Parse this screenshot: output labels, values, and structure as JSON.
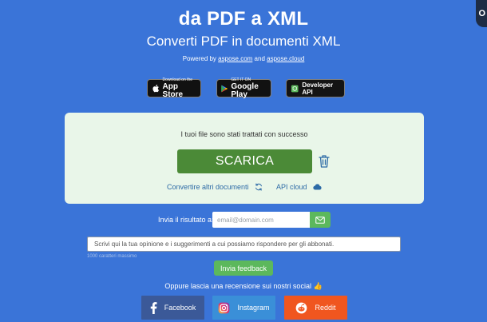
{
  "header": {
    "corner_label": "O",
    "title": "da PDF a XML",
    "subtitle": "Converti PDF in documenti XML",
    "powered_by": "Powered by",
    "powered_link1": "aspose.com",
    "powered_and": "and",
    "powered_link2": "aspose.cloud"
  },
  "stores": {
    "appstore_small": "Download on the",
    "appstore_big": "App Store",
    "googleplay_small": "GET IT ON",
    "googleplay_big": "Google Play",
    "devapi": "Developer API"
  },
  "result_panel": {
    "success_message": "I tuoi file sono stati trattati con successo",
    "download_label": "SCARICA",
    "convert_more": "Convertire altri documenti",
    "api_cloud": "API cloud"
  },
  "send_result": {
    "label": "Invia il risultato a:",
    "email_placeholder": "email@domain.com"
  },
  "feedback": {
    "placeholder": "Scrivi qui la tua opinione e i suggerimenti a cui possiamo rispondere per gli abbonati.",
    "char_limit": "1000 caratteri massimo",
    "submit_label": "Invia feedback",
    "review_text": "Oppure lascia una recensione sui nostri social 👍"
  },
  "social": {
    "facebook": "Facebook",
    "instagram": "Instagram",
    "reddit": "Reddit"
  },
  "colors": {
    "background": "#3a74d8",
    "panel": "#e9f6e9",
    "download": "#4b8a37",
    "accent_green": "#5cb85c",
    "facebook": "#3b5998",
    "instagram": "#3a8fd8",
    "reddit": "#f0561f"
  }
}
